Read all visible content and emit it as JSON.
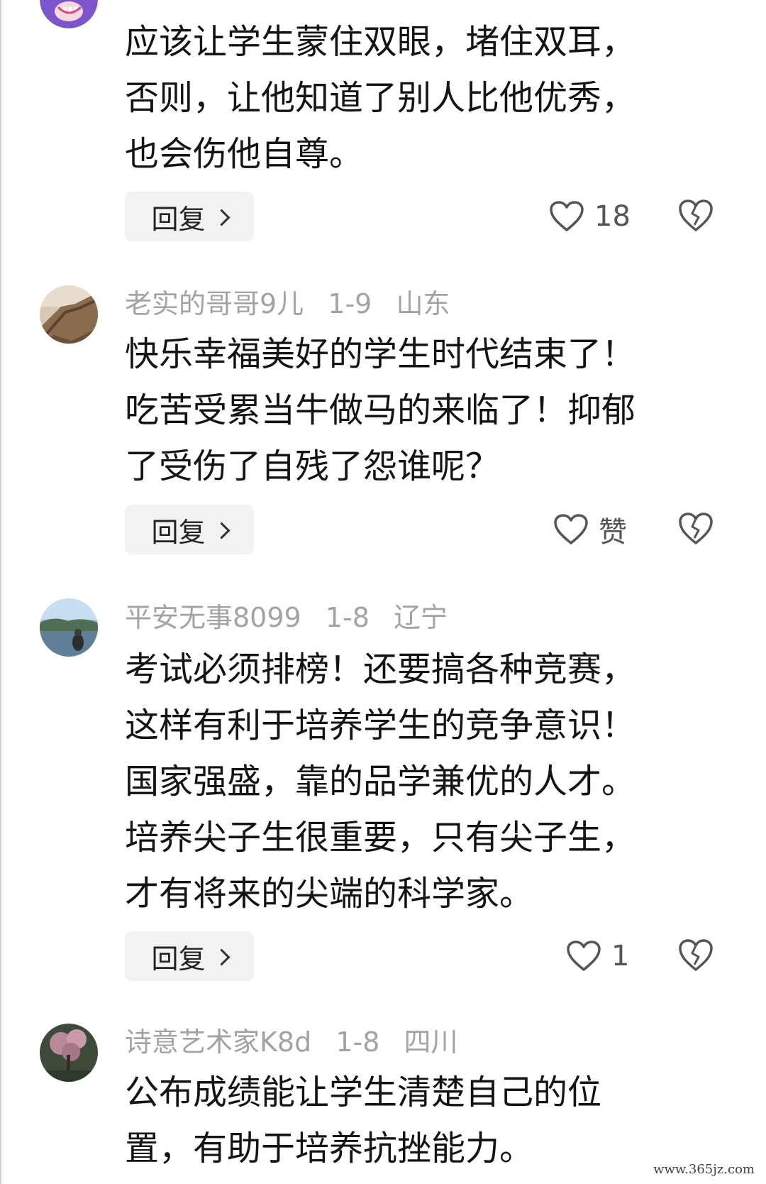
{
  "comments": [
    {
      "user": "",
      "date": "",
      "location": "",
      "lines": [
        "应该让学生蒙住双眼，堵住双耳，",
        "否则，让他知道了别人比他优秀，",
        "也会伤他自尊。"
      ],
      "reply_label": "回复",
      "like_text": "18",
      "avatar_icon": "cartoon-avatar"
    },
    {
      "user": "老实的哥哥9儿",
      "date": "1-9",
      "location": "山东",
      "lines": [
        "快乐幸福美好的学生时代结束了！",
        "吃苦受累当牛做马的来临了！抑郁",
        "了受伤了自残了怨谁呢？"
      ],
      "reply_label": "回复",
      "like_text": "赞",
      "avatar_icon": "great-wall-avatar"
    },
    {
      "user": "平安无事8099",
      "date": "1-8",
      "location": "辽宁",
      "lines": [
        "考试必须排榜！还要搞各种竞赛，",
        "这样有利于培养学生的竞争意识！",
        "国家强盛，靠的品学兼优的人才。",
        "培养尖子生很重要，只有尖子生，",
        "才有将来的尖端的科学家。"
      ],
      "reply_label": "回复",
      "like_text": "1",
      "avatar_icon": "lake-avatar"
    },
    {
      "user": "诗意艺术家K8d",
      "date": "1-8",
      "location": "四川",
      "lines": [
        "公布成绩能让学生清楚自己的位",
        "置，有助于培养抗挫能力。"
      ],
      "avatar_icon": "blossom-tree-avatar"
    }
  ],
  "watermark": "www.365jz.com",
  "colors": {
    "meta_text": "#a3a3a3",
    "body_text": "#141414",
    "reply_bg": "#f2f2f2",
    "icon_stroke": "#555555"
  }
}
